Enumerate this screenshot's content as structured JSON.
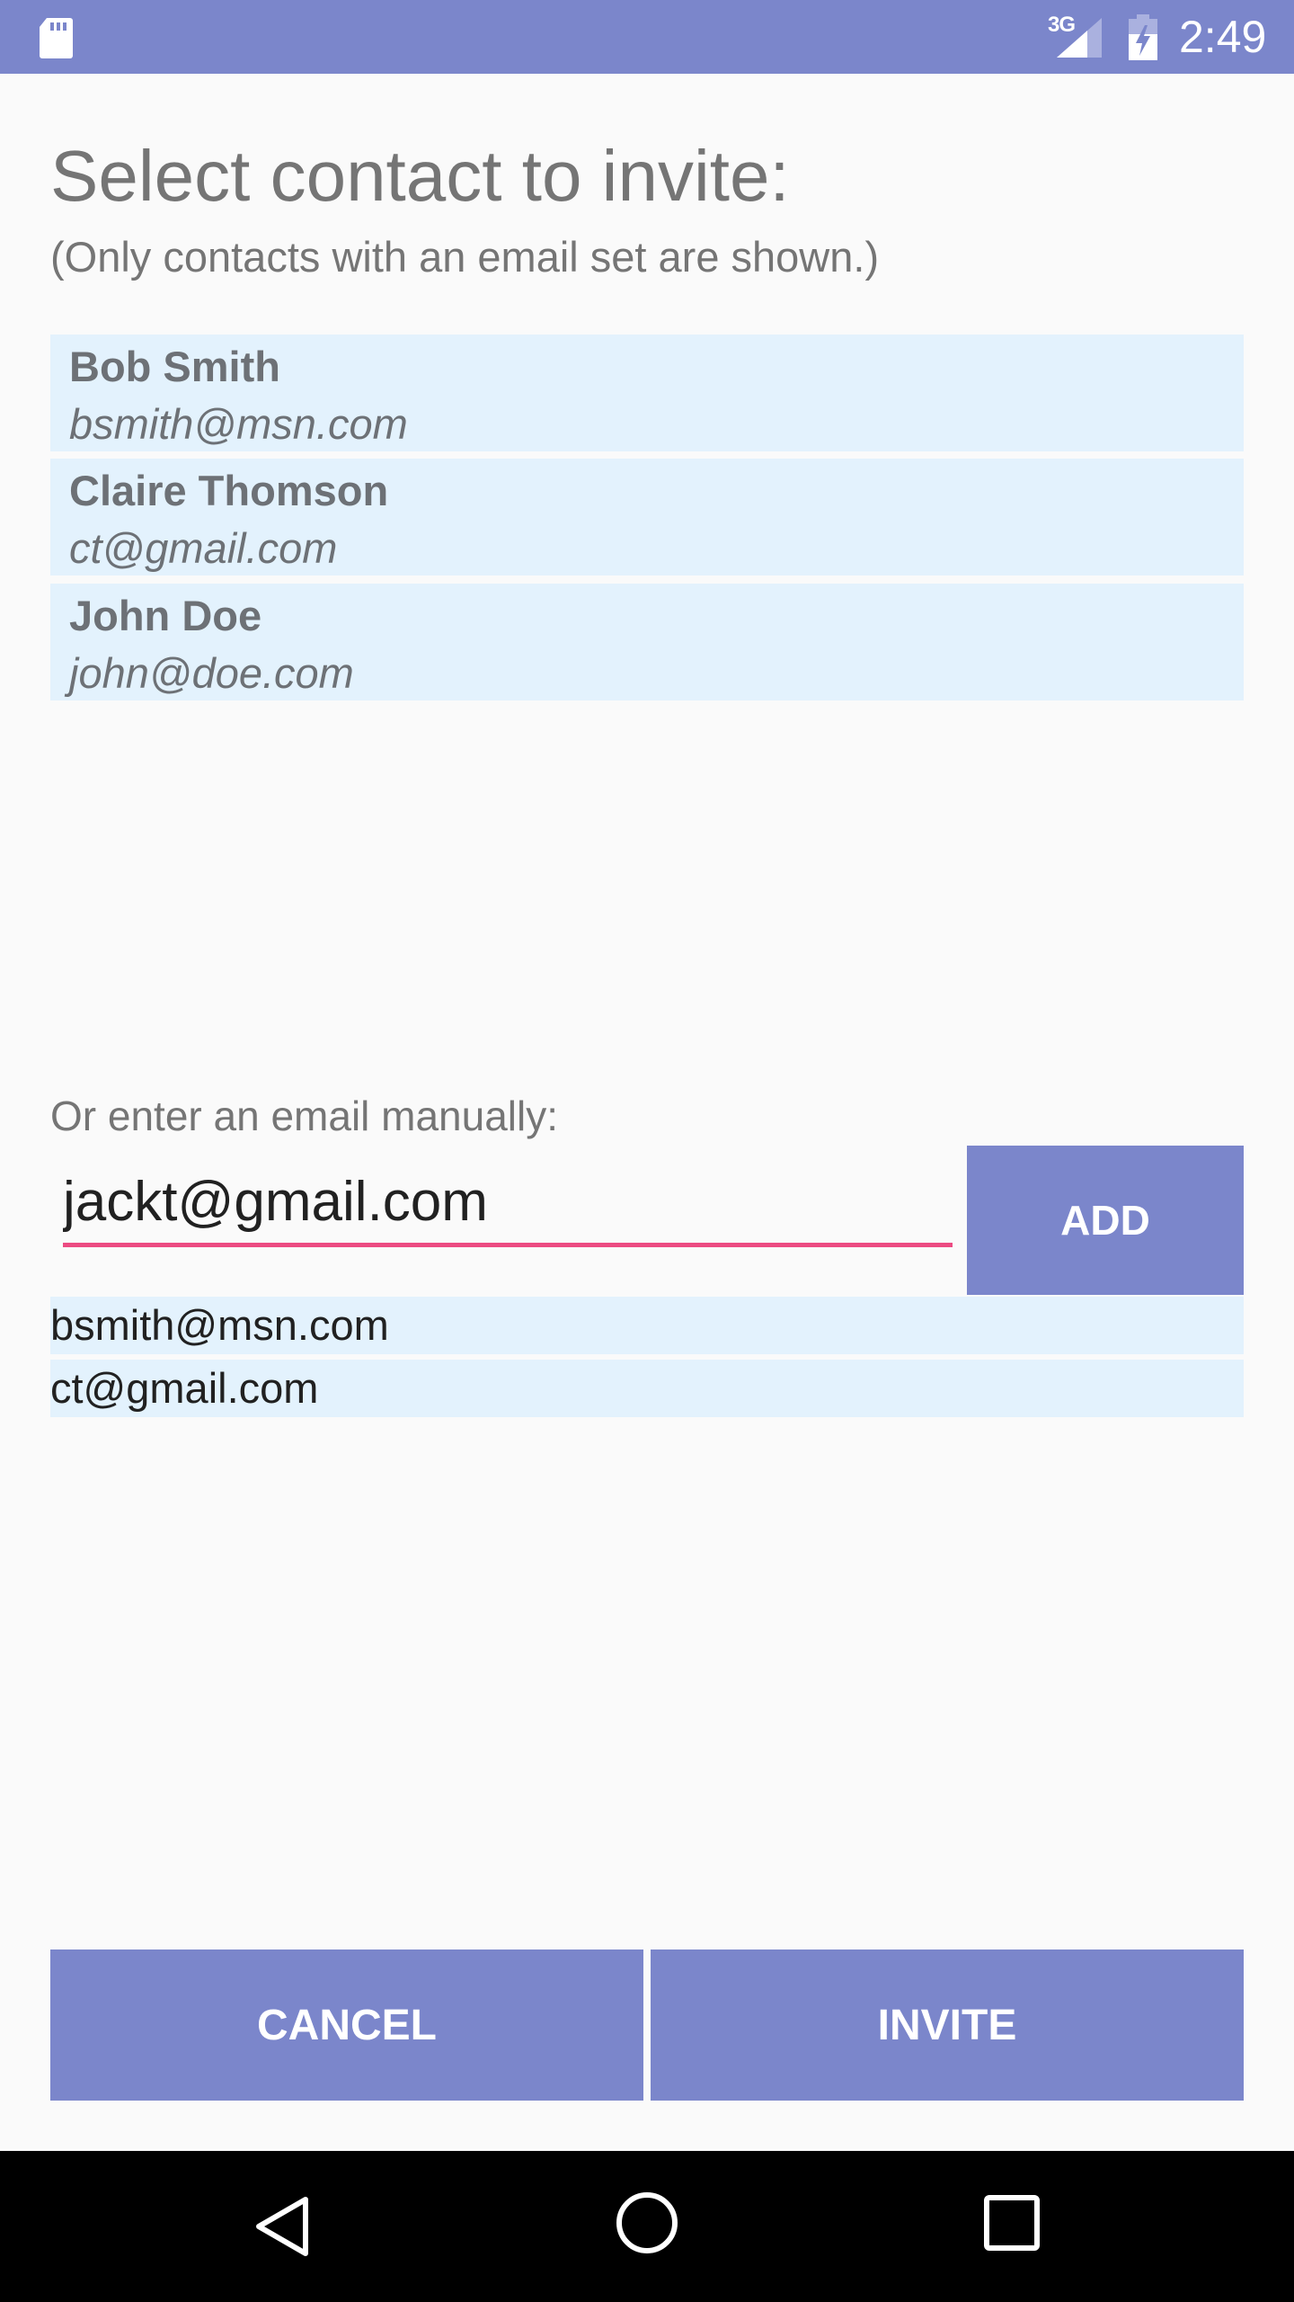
{
  "status_bar": {
    "network_label": "3G",
    "time": "2:49",
    "icons": [
      "sd-card-icon",
      "signal-icon",
      "battery-charging-icon"
    ]
  },
  "header": {
    "title": "Select contact to invite:",
    "subtitle": "(Only contacts with an email set are shown.)"
  },
  "contacts": [
    {
      "name": "Bob Smith",
      "email": "bsmith@msn.com"
    },
    {
      "name": "Claire Thomson",
      "email": "ct@gmail.com"
    },
    {
      "name": "John Doe",
      "email": "john@doe.com"
    }
  ],
  "manual_entry": {
    "label": "Or enter an email manually:",
    "value": "jackt@gmail.com",
    "add_label": "ADD"
  },
  "added_emails": [
    "bsmith@msn.com",
    "ct@gmail.com"
  ],
  "actions": {
    "cancel_label": "CANCEL",
    "invite_label": "INVITE"
  },
  "colors": {
    "primary": "#7b86cb",
    "accent": "#ec4b82",
    "list_background": "#e3f2fd",
    "background": "#fafafa"
  },
  "nav_bar": {
    "icons": [
      "back-icon",
      "home-icon",
      "recents-icon"
    ]
  }
}
